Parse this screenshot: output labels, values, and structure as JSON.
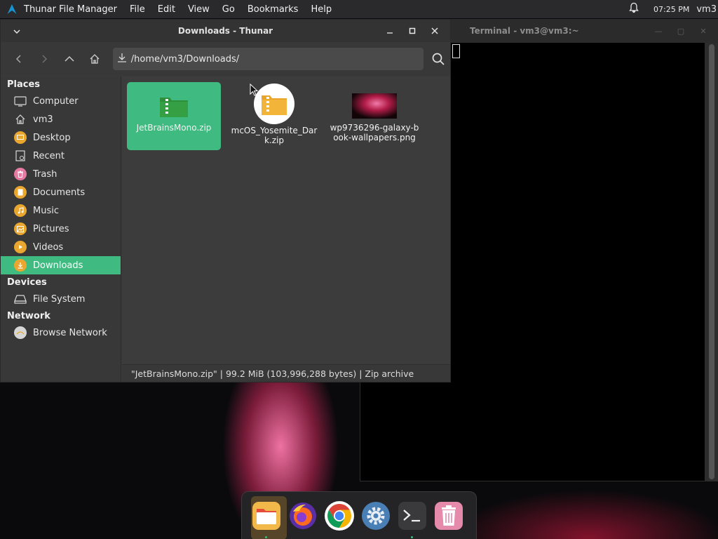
{
  "top_panel": {
    "app_name": "Thunar File Manager",
    "menu": [
      "File",
      "Edit",
      "View",
      "Go",
      "Bookmarks",
      "Help"
    ],
    "clock": "07:25 PM",
    "user": "vm3",
    "icons": {
      "logo": "arch-logo-icon",
      "notifications": "bell-icon"
    }
  },
  "thunar": {
    "title": "Downloads - Thunar",
    "path": "/home/vm3/Downloads/",
    "sidebar": {
      "places_title": "Places",
      "places": [
        {
          "label": "Computer",
          "icon": "computer-icon"
        },
        {
          "label": "vm3",
          "icon": "home-icon"
        },
        {
          "label": "Desktop",
          "icon": "desktop-folder-icon"
        },
        {
          "label": "Recent",
          "icon": "recent-icon"
        },
        {
          "label": "Trash",
          "icon": "trash-icon"
        },
        {
          "label": "Documents",
          "icon": "documents-folder-icon"
        },
        {
          "label": "Music",
          "icon": "music-folder-icon"
        },
        {
          "label": "Pictures",
          "icon": "pictures-folder-icon"
        },
        {
          "label": "Videos",
          "icon": "videos-folder-icon"
        },
        {
          "label": "Downloads",
          "icon": "downloads-folder-icon"
        }
      ],
      "devices_title": "Devices",
      "devices": [
        {
          "label": "File System",
          "icon": "drive-icon"
        }
      ],
      "network_title": "Network",
      "network": [
        {
          "label": "Browse Network",
          "icon": "network-icon"
        }
      ]
    },
    "files": [
      {
        "name": "JetBrainsMono.zip",
        "icon": "zip-archive-icon",
        "selected": true
      },
      {
        "name": "mcOS_Yosemite_Dark.zip",
        "icon": "zip-archive-icon",
        "selected": false
      },
      {
        "name": "wp9736296-galaxy-book-wallpapers.png",
        "icon": "image-thumbnail-icon",
        "selected": false
      }
    ],
    "status": "\"JetBrainsMono.zip\"  |  99.2 MiB (103,996,288 bytes)  |  Zip archive"
  },
  "terminal": {
    "title": "Terminal - vm3@vm3:~"
  },
  "dock": {
    "items": [
      "file-manager-icon",
      "firefox-icon",
      "chrome-icon",
      "settings-icon",
      "terminal-icon",
      "trash-icon"
    ]
  },
  "colors": {
    "accent": "#3fba80",
    "folder": "#eaa72f",
    "panel_bg": "#2a2a2c",
    "window_bg": "#3a3a3a"
  }
}
